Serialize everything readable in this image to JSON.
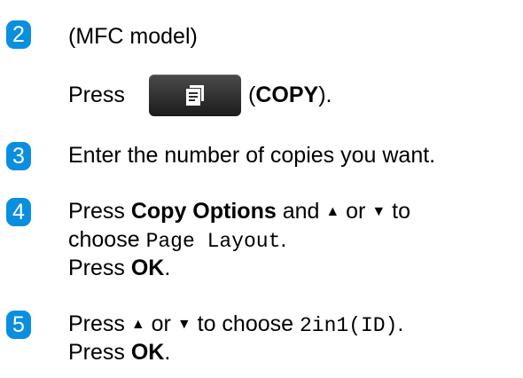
{
  "steps": [
    {
      "number": "2",
      "line1": "(MFC model)",
      "line2_prefix": "Press",
      "line2_open": "(",
      "line2_bold": "COPY",
      "line2_close": ")."
    },
    {
      "number": "3",
      "line1": "Enter the number of copies you want."
    },
    {
      "number": "4",
      "line1_prefix": "Press ",
      "line1_bold": "Copy Options",
      "line1_mid": " and ",
      "up_arrow": "▲",
      "line1_or": " or ",
      "down_arrow": "▼",
      "line1_suffix": " to",
      "line2_prefix": "choose ",
      "line2_mono": "Page Layout",
      "line2_suffix": ".",
      "line3_prefix": "Press ",
      "line3_bold": "OK",
      "line3_suffix": "."
    },
    {
      "number": "5",
      "line1_prefix": "Press ",
      "up_arrow": "▲",
      "line1_or": " or ",
      "down_arrow": "▼",
      "line1_mid": " to choose ",
      "line1_mono": "2in1(ID)",
      "line1_suffix": ".",
      "line2_prefix": "Press ",
      "line2_bold": "OK",
      "line2_suffix": "."
    }
  ],
  "icons": {
    "step_badge_color": "#0a8fe0",
    "copy_button_icon": "copy-document-icon",
    "copy_button_color": "#2a2a2a"
  }
}
